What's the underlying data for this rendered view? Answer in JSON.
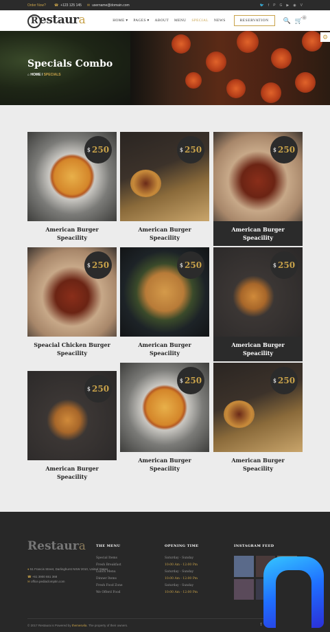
{
  "topbar": {
    "order_label": "Order Now?",
    "phone": "+123 125 145",
    "email": "username@domain.com",
    "social": [
      "🐦",
      "f",
      "P",
      "G",
      "▶",
      "◉",
      "V"
    ]
  },
  "nav": {
    "logo_r": "R",
    "logo_main": "estaur",
    "logo_a": "a",
    "menu": [
      "HOME ▾",
      "PAGES ▾",
      "ABOUT",
      "MENU",
      "SPECIAL",
      "NEWS"
    ],
    "reservation": "RESERVATION",
    "cart_count": "0"
  },
  "hero": {
    "title": "Specials Combo",
    "crumb_home": "HOME",
    "crumb_sep": "/",
    "crumb_current": "SPECIALS"
  },
  "items": [
    {
      "price": "250",
      "currency": "$",
      "title": "American Burger Speacility",
      "image": "pizza"
    },
    {
      "price": "250",
      "currency": "$",
      "title": "American Burger Speacility",
      "image": "burger"
    },
    {
      "price": "250",
      "currency": "$",
      "title": "American Burger Speacility",
      "image": "wings"
    },
    {
      "price": "250",
      "currency": "$",
      "title": "Speacial Chicken Burger Speacility",
      "image": "wings"
    },
    {
      "price": "250",
      "currency": "$",
      "title": "American Burger Speacility",
      "image": "chicken"
    },
    {
      "price": "250",
      "currency": "$",
      "title": "American Burger Speacility",
      "image": "topburger"
    },
    {
      "price": "250",
      "currency": "$",
      "title": "American Burger Speacility",
      "image": "topburger"
    },
    {
      "price": "250",
      "currency": "$",
      "title": "American Burger Speacility",
      "image": "pizza"
    },
    {
      "price": "250",
      "currency": "$",
      "title": "American Burger Speacility",
      "image": "burger"
    }
  ],
  "footer": {
    "logo_main": "Restaur",
    "logo_a": "a",
    "address": "51 Francis Street, Darlinghurst NSW 2010, United States",
    "phone": "+61 3900 651 368",
    "email": "office.pediaclomptin.com",
    "menu_title": "THE MENU",
    "menu_items": [
      "Special Items",
      "Fresh Breakfast",
      "Lunch Menu",
      "Dinner Items",
      "Fresh Food Zone",
      "We Offerd Food"
    ],
    "hours_title": "OPENING TIME",
    "hours": [
      {
        "day": "Saturday - Sunday",
        "time": "10:00 Am - 12:00 Pm"
      },
      {
        "day": "Saturday - Sunday",
        "time": "10:00 Am - 12:00 Pm"
      },
      {
        "day": "Saturday - Sunday",
        "time": "10:00 Am - 12:00 Pm"
      }
    ],
    "insta_title": "INSTAGRAM FEED",
    "copyright_pre": "© 2017 Restaura is Powered by",
    "copyright_brand": "themesvila",
    "copyright_post": "The property of their owners.",
    "social": [
      "f",
      "🐦",
      "◎",
      "V",
      "Be",
      "⊗",
      "◯"
    ]
  },
  "colors": {
    "accent": "#c8a24a",
    "dark": "#2b2b2b"
  }
}
